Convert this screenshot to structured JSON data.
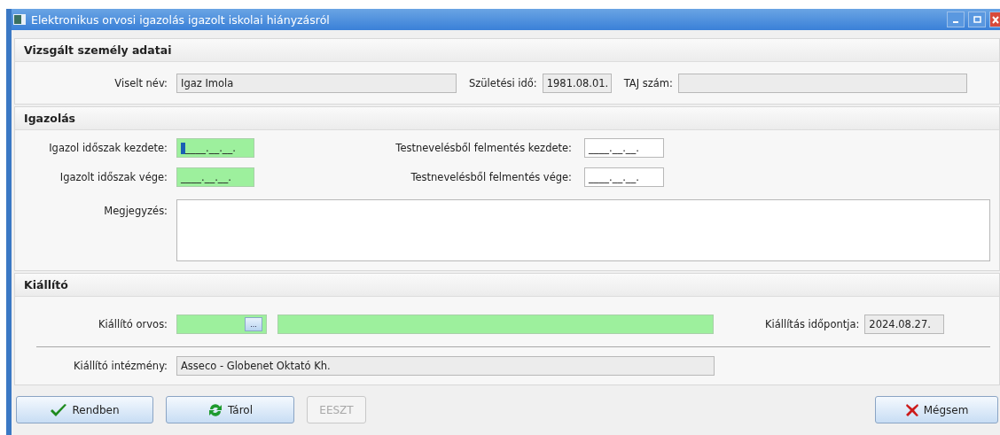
{
  "window": {
    "title": "Elektronikus orvosi igazolás igazolt iskolai hiányzásról"
  },
  "person": {
    "title": "Vizsgált személy adatai",
    "name_label": "Viselt név:",
    "name_value": "Igaz Imola",
    "birth_label": "Születési idő:",
    "birth_value": "1981.08.01.",
    "taj_label": "TAJ szám:"
  },
  "certificate": {
    "title": "Igazolás",
    "rows": [
      {
        "label": "Igazol időszak kezdete:",
        "value": "____.__.__.",
        "required": true,
        "focused": true,
        "pe_label": "Testnevelésből felmentés kezdete:",
        "pe_value": "____.__.__."
      },
      {
        "label": "Igazolt időszak vége:",
        "value": "____.__.__.",
        "required": true,
        "focused": false,
        "pe_label": "Testnevelésből felmentés vége:",
        "pe_value": "____.__.__."
      }
    ],
    "note_label": "Megjegyzés:"
  },
  "issuer": {
    "title": "Kiállító",
    "doctor_label": "Kiállító orvos:",
    "browse_button": "...",
    "date_label": "Kiállítás időpontja:",
    "date_value": "2024.08.27.",
    "institution_label": "Kiállító intézmény:",
    "institution_value": "Asseco - Globenet Oktató Kh."
  },
  "buttons": [
    {
      "label": "Rendben",
      "kind": "ok",
      "disabled": false
    },
    {
      "label": "Tárol",
      "kind": "save",
      "disabled": false
    },
    {
      "label": "EESZT",
      "kind": "plain",
      "disabled": true
    },
    {
      "label": "Mégsem",
      "kind": "cancel",
      "disabled": false
    }
  ]
}
